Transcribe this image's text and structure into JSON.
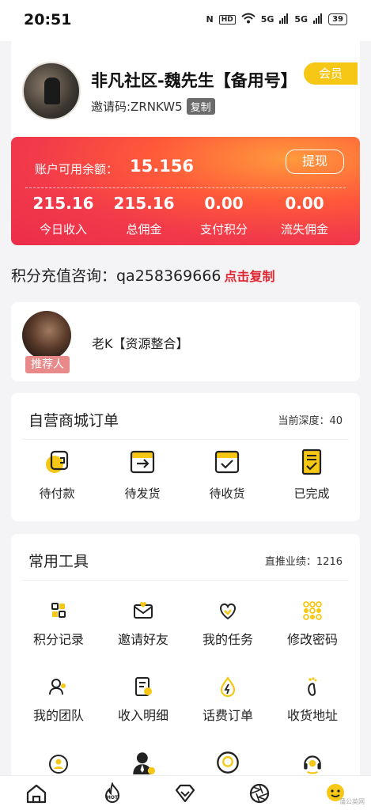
{
  "status": {
    "time": "20:51",
    "nfc": "N",
    "hd": "HD",
    "sig1": "5G",
    "sig2": "5G",
    "battery": "39"
  },
  "profile": {
    "name": "非凡社区-魏先生【备用号】",
    "invite_label": "邀请码:ZRNKW5",
    "copy_label": "复制",
    "member_label": "会员"
  },
  "balance": {
    "label": "账户可用余额：",
    "value": "15.156",
    "withdraw_label": "提现",
    "stats": [
      {
        "value": "215.16",
        "label": "今日收入"
      },
      {
        "value": "215.16",
        "label": "总佣金"
      },
      {
        "value": "0.00",
        "label": "支付积分"
      },
      {
        "value": "0.00",
        "label": "流失佣金"
      }
    ]
  },
  "recharge": {
    "text": "积分充值咨询：qa258369666",
    "copy_label": "点击复制"
  },
  "referrer": {
    "name": "老K【资源整合】",
    "tag": "推荐人"
  },
  "orders": {
    "title": "自营商城订单",
    "depth": "当前深度：40",
    "items": [
      {
        "label": "待付款",
        "icon": "wallet-icon"
      },
      {
        "label": "待发货",
        "icon": "box-send-icon"
      },
      {
        "label": "待收货",
        "icon": "box-check-icon"
      },
      {
        "label": "已完成",
        "icon": "clipboard-check-icon"
      }
    ]
  },
  "tools": {
    "title": "常用工具",
    "performance": "直推业绩：1216",
    "items": [
      {
        "label": "积分记录",
        "icon": "points-record-icon"
      },
      {
        "label": "邀请好友",
        "icon": "invite-envelope-icon"
      },
      {
        "label": "我的任务",
        "icon": "heart-task-icon"
      },
      {
        "label": "修改密码",
        "icon": "grid-dots-icon"
      },
      {
        "label": "我的团队",
        "icon": "team-icon"
      },
      {
        "label": "收入明细",
        "icon": "income-detail-icon"
      },
      {
        "label": "话费订单",
        "icon": "drop-bolt-icon"
      },
      {
        "label": "收货地址",
        "icon": "footprint-icon"
      },
      {
        "label": "",
        "icon": "user-coin-icon"
      },
      {
        "label": "",
        "icon": "agent-icon"
      },
      {
        "label": "",
        "icon": "circle-badge-icon"
      },
      {
        "label": "",
        "icon": "support-headset-icon"
      }
    ]
  },
  "nav": [
    {
      "name": "home-icon"
    },
    {
      "name": "hot-icon"
    },
    {
      "name": "diamond-icon"
    },
    {
      "name": "aperture-icon"
    },
    {
      "name": "profile-smile-icon"
    }
  ],
  "colors": {
    "brand_yellow": "#f6c815",
    "card_red": "#f23a4a",
    "accent_red": "#e0262f"
  },
  "watermark": "蒲公英网"
}
